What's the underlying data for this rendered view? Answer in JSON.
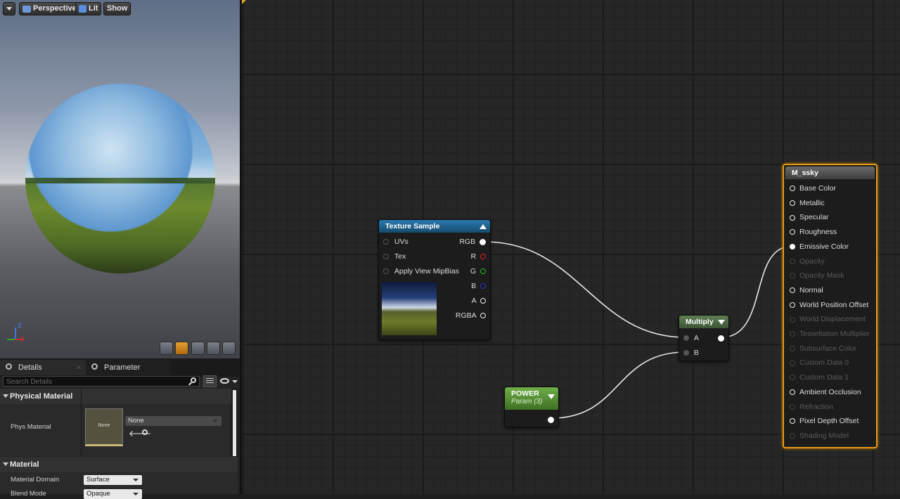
{
  "viewport": {
    "perspective_label": "Perspective",
    "lit_label": "Lit",
    "show_label": "Show",
    "axis_z": "Z",
    "axis_x": "X"
  },
  "details_panel": {
    "tabs": [
      "Details",
      "Parameter Defaults"
    ],
    "search_placeholder": "Search Details",
    "physical_material_category": "Physical Material",
    "phys_material_label": "Phys Material",
    "phys_material_thumb": "None",
    "phys_material_value": "None",
    "material_category": "Material",
    "material_domain_label": "Material Domain",
    "material_domain_value": "Surface",
    "blend_mode_label": "Blend Mode",
    "blend_mode_value": "Opaque"
  },
  "graph": {
    "texture_sample": {
      "title": "Texture Sample",
      "inputs": [
        "UVs",
        "Tex",
        "Apply View MipBias"
      ],
      "outputs": [
        "RGB",
        "R",
        "G",
        "B",
        "A",
        "RGBA"
      ]
    },
    "multiply": {
      "title": "Multiply",
      "inputs": [
        "A",
        "B"
      ]
    },
    "power": {
      "title": "POWER",
      "subtitle": "Param (3)"
    },
    "material": {
      "title": "M_ssky",
      "inputs": [
        {
          "label": "Base Color",
          "enabled": true
        },
        {
          "label": "Metallic",
          "enabled": true
        },
        {
          "label": "Specular",
          "enabled": true
        },
        {
          "label": "Roughness",
          "enabled": true
        },
        {
          "label": "Emissive Color",
          "enabled": true
        },
        {
          "label": "Opacity",
          "enabled": false
        },
        {
          "label": "Opacity Mask",
          "enabled": false
        },
        {
          "label": "Normal",
          "enabled": true
        },
        {
          "label": "World Position Offset",
          "enabled": true
        },
        {
          "label": "World Displacement",
          "enabled": false
        },
        {
          "label": "Tessellation Multiplier",
          "enabled": false
        },
        {
          "label": "Subsurface Color",
          "enabled": false
        },
        {
          "label": "Custom Data 0",
          "enabled": false
        },
        {
          "label": "Custom Data 1",
          "enabled": false
        },
        {
          "label": "Ambient Occlusion",
          "enabled": true
        },
        {
          "label": "Refraction",
          "enabled": false
        },
        {
          "label": "Pixel Depth Offset",
          "enabled": true
        },
        {
          "label": "Shading Model",
          "enabled": false
        }
      ]
    },
    "colors": {
      "texture_header": "#1f5f86",
      "multiply_header": "#4d6b44",
      "power_header": "#5f9e3b",
      "material_border": "#e39a13",
      "pin_r": "#e02020",
      "pin_g": "#23c023",
      "pin_b": "#2a36d8"
    }
  }
}
